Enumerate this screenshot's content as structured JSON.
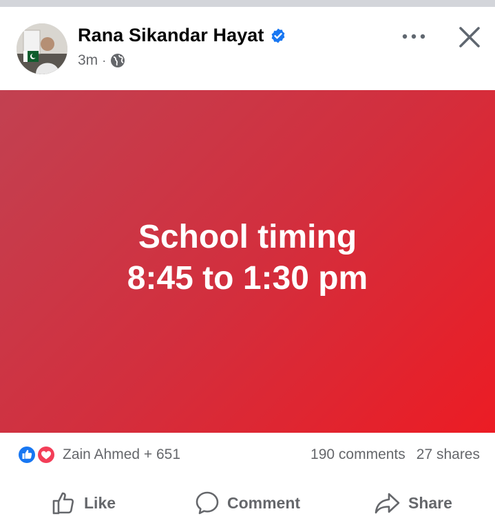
{
  "post": {
    "author": "Rana Sikandar Hayat",
    "verified": true,
    "time": "3m",
    "separator": "·",
    "privacy_icon": "globe-icon",
    "image_text": [
      "School timing",
      "8:45 to 1:30 pm"
    ],
    "image_gradient": [
      "#c24151",
      "#ec1c24"
    ]
  },
  "header_controls": {
    "more_icon": "more-horizontal-icon",
    "close_icon": "close-icon"
  },
  "reactions": {
    "icons": [
      "like-icon",
      "love-icon"
    ],
    "names": "Zain Ahmed + 651",
    "comments": "190 comments",
    "shares": "27 shares"
  },
  "actions": {
    "like": "Like",
    "comment": "Comment",
    "share": "Share"
  },
  "colors": {
    "brand_blue": "#1877f2",
    "love_red": "#f33e58",
    "secondary_text": "#65676b"
  }
}
